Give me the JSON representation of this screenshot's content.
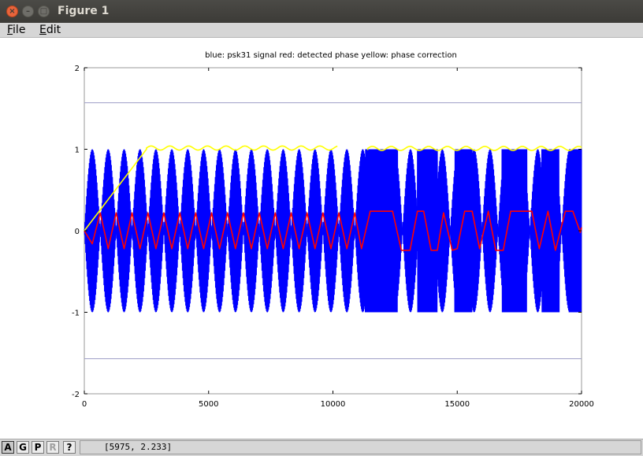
{
  "window": {
    "title": "Figure 1",
    "close_glyph": "×",
    "minimize_glyph": "–",
    "maximize_glyph": "□"
  },
  "menu": {
    "file_mnemonic": "F",
    "file_rest": "ile",
    "edit_mnemonic": "E",
    "edit_rest": "dit"
  },
  "toolbar": {
    "autoscale_label": "A",
    "grid_label": "G",
    "pan_label": "P",
    "rotate_label": "R",
    "help_label": "?",
    "coordinates": "[5975, 2.233]"
  },
  "chart_data": {
    "type": "line",
    "title": "blue: psk31 signal    red: detected phase    yellow: phase correction",
    "xlim": [
      0,
      20000
    ],
    "ylim": [
      -2,
      2
    ],
    "x_ticks": [
      0,
      5000,
      10000,
      15000,
      20000
    ],
    "y_ticks": [
      2,
      1,
      0,
      -1,
      -2
    ],
    "x_tick_labels": [
      "0",
      "5000",
      "10000",
      "15000",
      "20000"
    ],
    "y_tick_labels": [
      "2",
      "1",
      "0",
      "-1",
      "-2"
    ],
    "grid": false,
    "reference_lines_y": [
      1.57,
      -1.57
    ],
    "series": [
      {
        "color": "#0000ff",
        "kind": "psk31_signal",
        "amplitude": 1.0,
        "envelope_period": 640,
        "solid_spans": [
          [
            11300,
            12600
          ],
          [
            13400,
            14200
          ],
          [
            14900,
            15600
          ],
          [
            16800,
            17800
          ],
          [
            18400,
            19100
          ],
          [
            19500,
            20000
          ]
        ]
      },
      {
        "color": "#ff0000",
        "kind": "detected_phase",
        "points": [
          [
            0,
            0
          ],
          [
            320,
            -0.16
          ],
          [
            640,
            0.22
          ],
          [
            960,
            -0.22
          ],
          [
            1280,
            0.22
          ],
          [
            1600,
            -0.22
          ],
          [
            1920,
            0.22
          ],
          [
            2240,
            -0.22
          ],
          [
            2560,
            0.22
          ],
          [
            2880,
            -0.22
          ],
          [
            3200,
            0.22
          ],
          [
            3520,
            -0.22
          ],
          [
            3840,
            0.22
          ],
          [
            4160,
            -0.22
          ],
          [
            4480,
            0.22
          ],
          [
            4800,
            -0.22
          ],
          [
            5120,
            0.22
          ],
          [
            5440,
            -0.22
          ],
          [
            5760,
            0.22
          ],
          [
            6080,
            -0.22
          ],
          [
            6400,
            0.22
          ],
          [
            6720,
            -0.22
          ],
          [
            7040,
            0.22
          ],
          [
            7360,
            -0.22
          ],
          [
            7680,
            0.22
          ],
          [
            8000,
            -0.22
          ],
          [
            8320,
            0.22
          ],
          [
            8640,
            -0.22
          ],
          [
            8960,
            0.22
          ],
          [
            9280,
            -0.22
          ],
          [
            9600,
            0.22
          ],
          [
            9920,
            -0.22
          ],
          [
            10240,
            0.22
          ],
          [
            10560,
            -0.22
          ],
          [
            10880,
            0.22
          ],
          [
            11150,
            -0.22
          ],
          [
            11500,
            0.24
          ],
          [
            12400,
            0.24
          ],
          [
            12750,
            -0.24
          ],
          [
            13100,
            -0.24
          ],
          [
            13400,
            0.24
          ],
          [
            13650,
            0.24
          ],
          [
            13950,
            -0.24
          ],
          [
            14200,
            -0.24
          ],
          [
            14450,
            0.22
          ],
          [
            14800,
            -0.24
          ],
          [
            15000,
            -0.22
          ],
          [
            15300,
            0.24
          ],
          [
            15600,
            0.24
          ],
          [
            15900,
            -0.22
          ],
          [
            16250,
            0.24
          ],
          [
            16550,
            -0.24
          ],
          [
            16850,
            -0.24
          ],
          [
            17150,
            0.24
          ],
          [
            18000,
            0.24
          ],
          [
            18300,
            -0.22
          ],
          [
            18650,
            0.24
          ],
          [
            18950,
            -0.24
          ],
          [
            19350,
            0.24
          ],
          [
            19650,
            0.24
          ],
          [
            19950,
            -0.02
          ],
          [
            20000,
            0.04
          ]
        ]
      },
      {
        "color": "#ffff00",
        "kind": "phase_correction",
        "points": [
          [
            0,
            0
          ],
          [
            2500,
            1.0
          ],
          [
            2700,
            1.04
          ],
          [
            10200,
            1.0
          ]
        ],
        "gap": [
          10200,
          11400
        ],
        "resume": [
          [
            11400,
            0.99
          ],
          [
            20000,
            1.03
          ]
        ]
      }
    ]
  }
}
